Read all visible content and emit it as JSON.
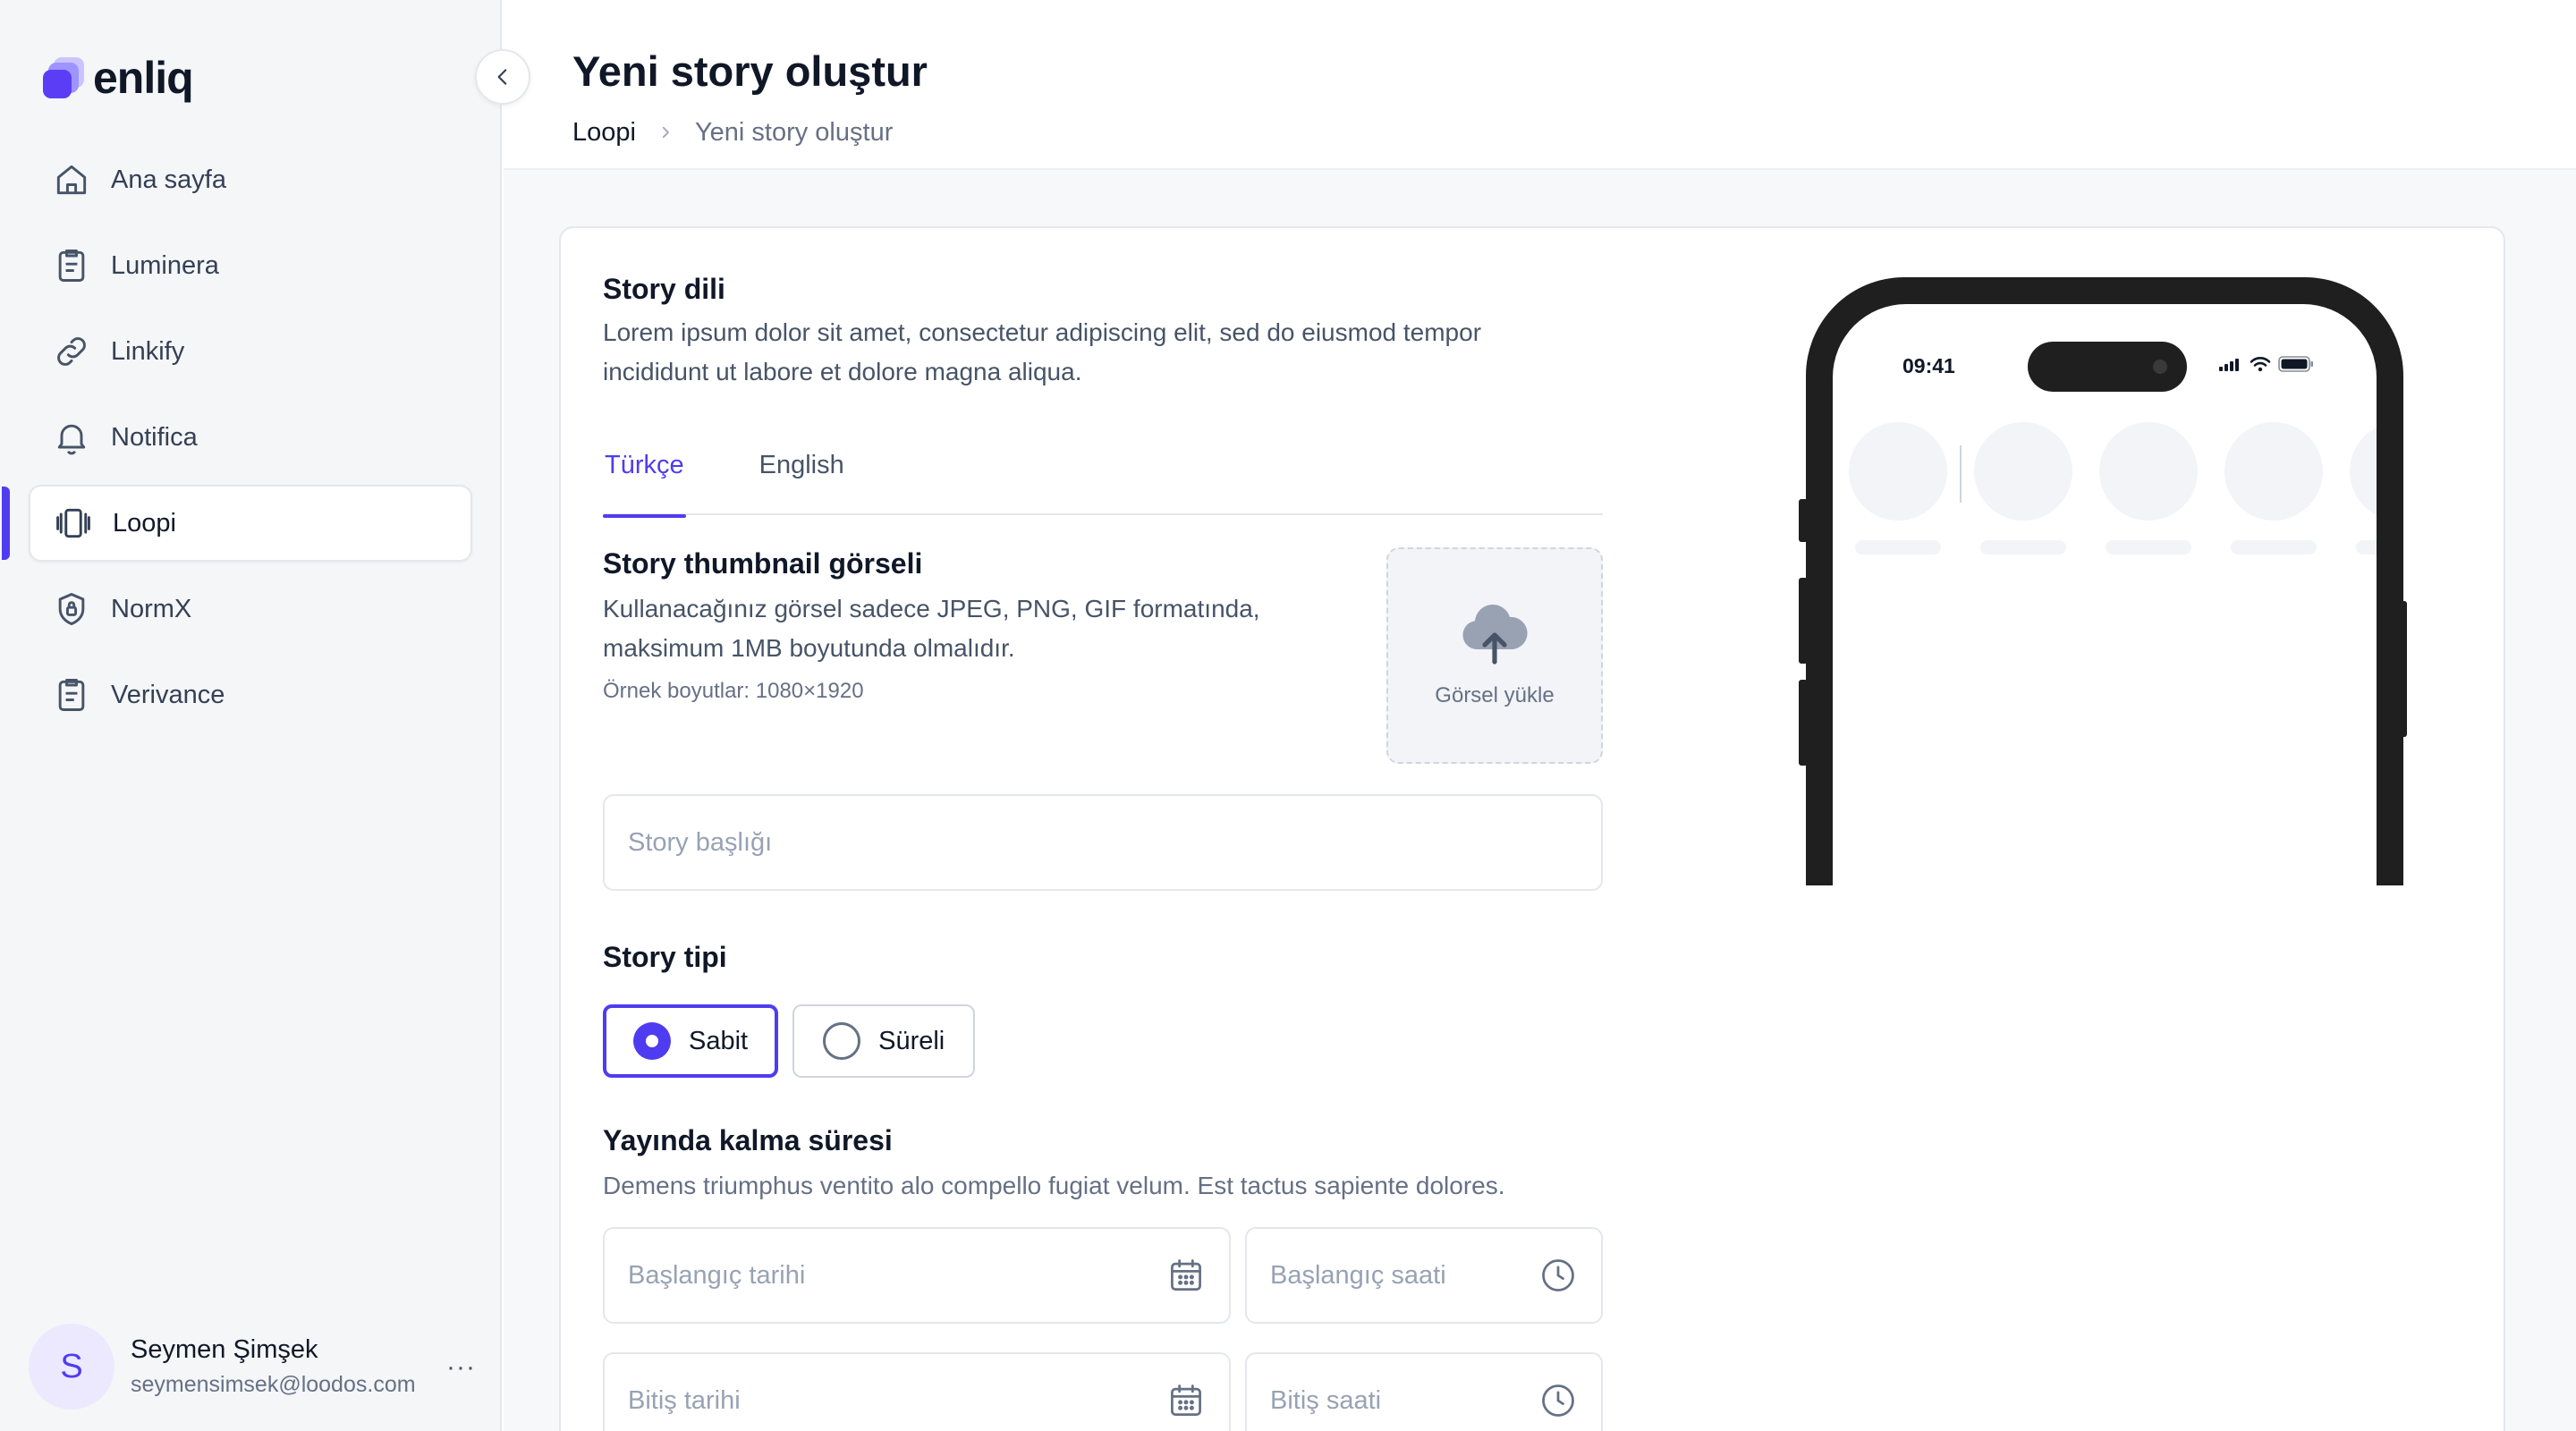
{
  "brand": {
    "name": "enliq"
  },
  "sidebar": {
    "items": [
      {
        "label": "Ana sayfa",
        "icon": "home-icon"
      },
      {
        "label": "Luminera",
        "icon": "clipboard-icon"
      },
      {
        "label": "Linkify",
        "icon": "link-icon"
      },
      {
        "label": "Notifica",
        "icon": "bell-icon"
      },
      {
        "label": "Loopi",
        "icon": "stories-icon",
        "active": true
      },
      {
        "label": "NormX",
        "icon": "shield-lock-icon"
      },
      {
        "label": "Verivance",
        "icon": "clipboard-icon"
      }
    ],
    "user": {
      "initial": "S",
      "name": "Seymen Şimşek",
      "email": "seymensimsek@loodos.com",
      "more": "···"
    }
  },
  "header": {
    "title": "Yeni story oluştur",
    "breadcrumb": [
      "Loopi",
      "Yeni story oluştur"
    ]
  },
  "form": {
    "language": {
      "title": "Story dili",
      "description_line1": "Lorem ipsum dolor sit amet, consectetur adipiscing elit, sed do eiusmod tempor",
      "description_line2": "incididunt ut labore et dolore magna aliqua.",
      "tabs": [
        "Türkçe",
        "English"
      ],
      "active_tab": "Türkçe"
    },
    "thumbnail": {
      "title": "Story thumbnail görseli",
      "description_line1": "Kullanacağınız görsel sadece JPEG, PNG, GIF formatında,",
      "description_line2": "maksimum 1MB boyutunda olmalıdır.",
      "hint": "Örnek boyutlar: 1080×1920",
      "upload_label": "Görsel yükle"
    },
    "title_input": {
      "placeholder": "Story başlığı",
      "value": ""
    },
    "story_type": {
      "title": "Story tipi",
      "options": [
        "Sabit",
        "Süreli"
      ],
      "selected": "Sabit"
    },
    "duration": {
      "title": "Yayında kalma süresi",
      "description": "Demens triumphus ventito alo compello fugiat velum. Est tactus sapiente dolores.",
      "start_date_placeholder": "Başlangıç tarihi",
      "start_time_placeholder": "Başlangıç saati",
      "end_date_placeholder": "Bitiş tarihi",
      "end_time_placeholder": "Bitiş saati"
    }
  },
  "preview": {
    "status_time": "09:41"
  },
  "colors": {
    "accent": "#4f3cf0",
    "sidebar_bg": "#f5f6f8",
    "border": "#e4e7ec",
    "phone_frame": "#1f1f1f"
  }
}
